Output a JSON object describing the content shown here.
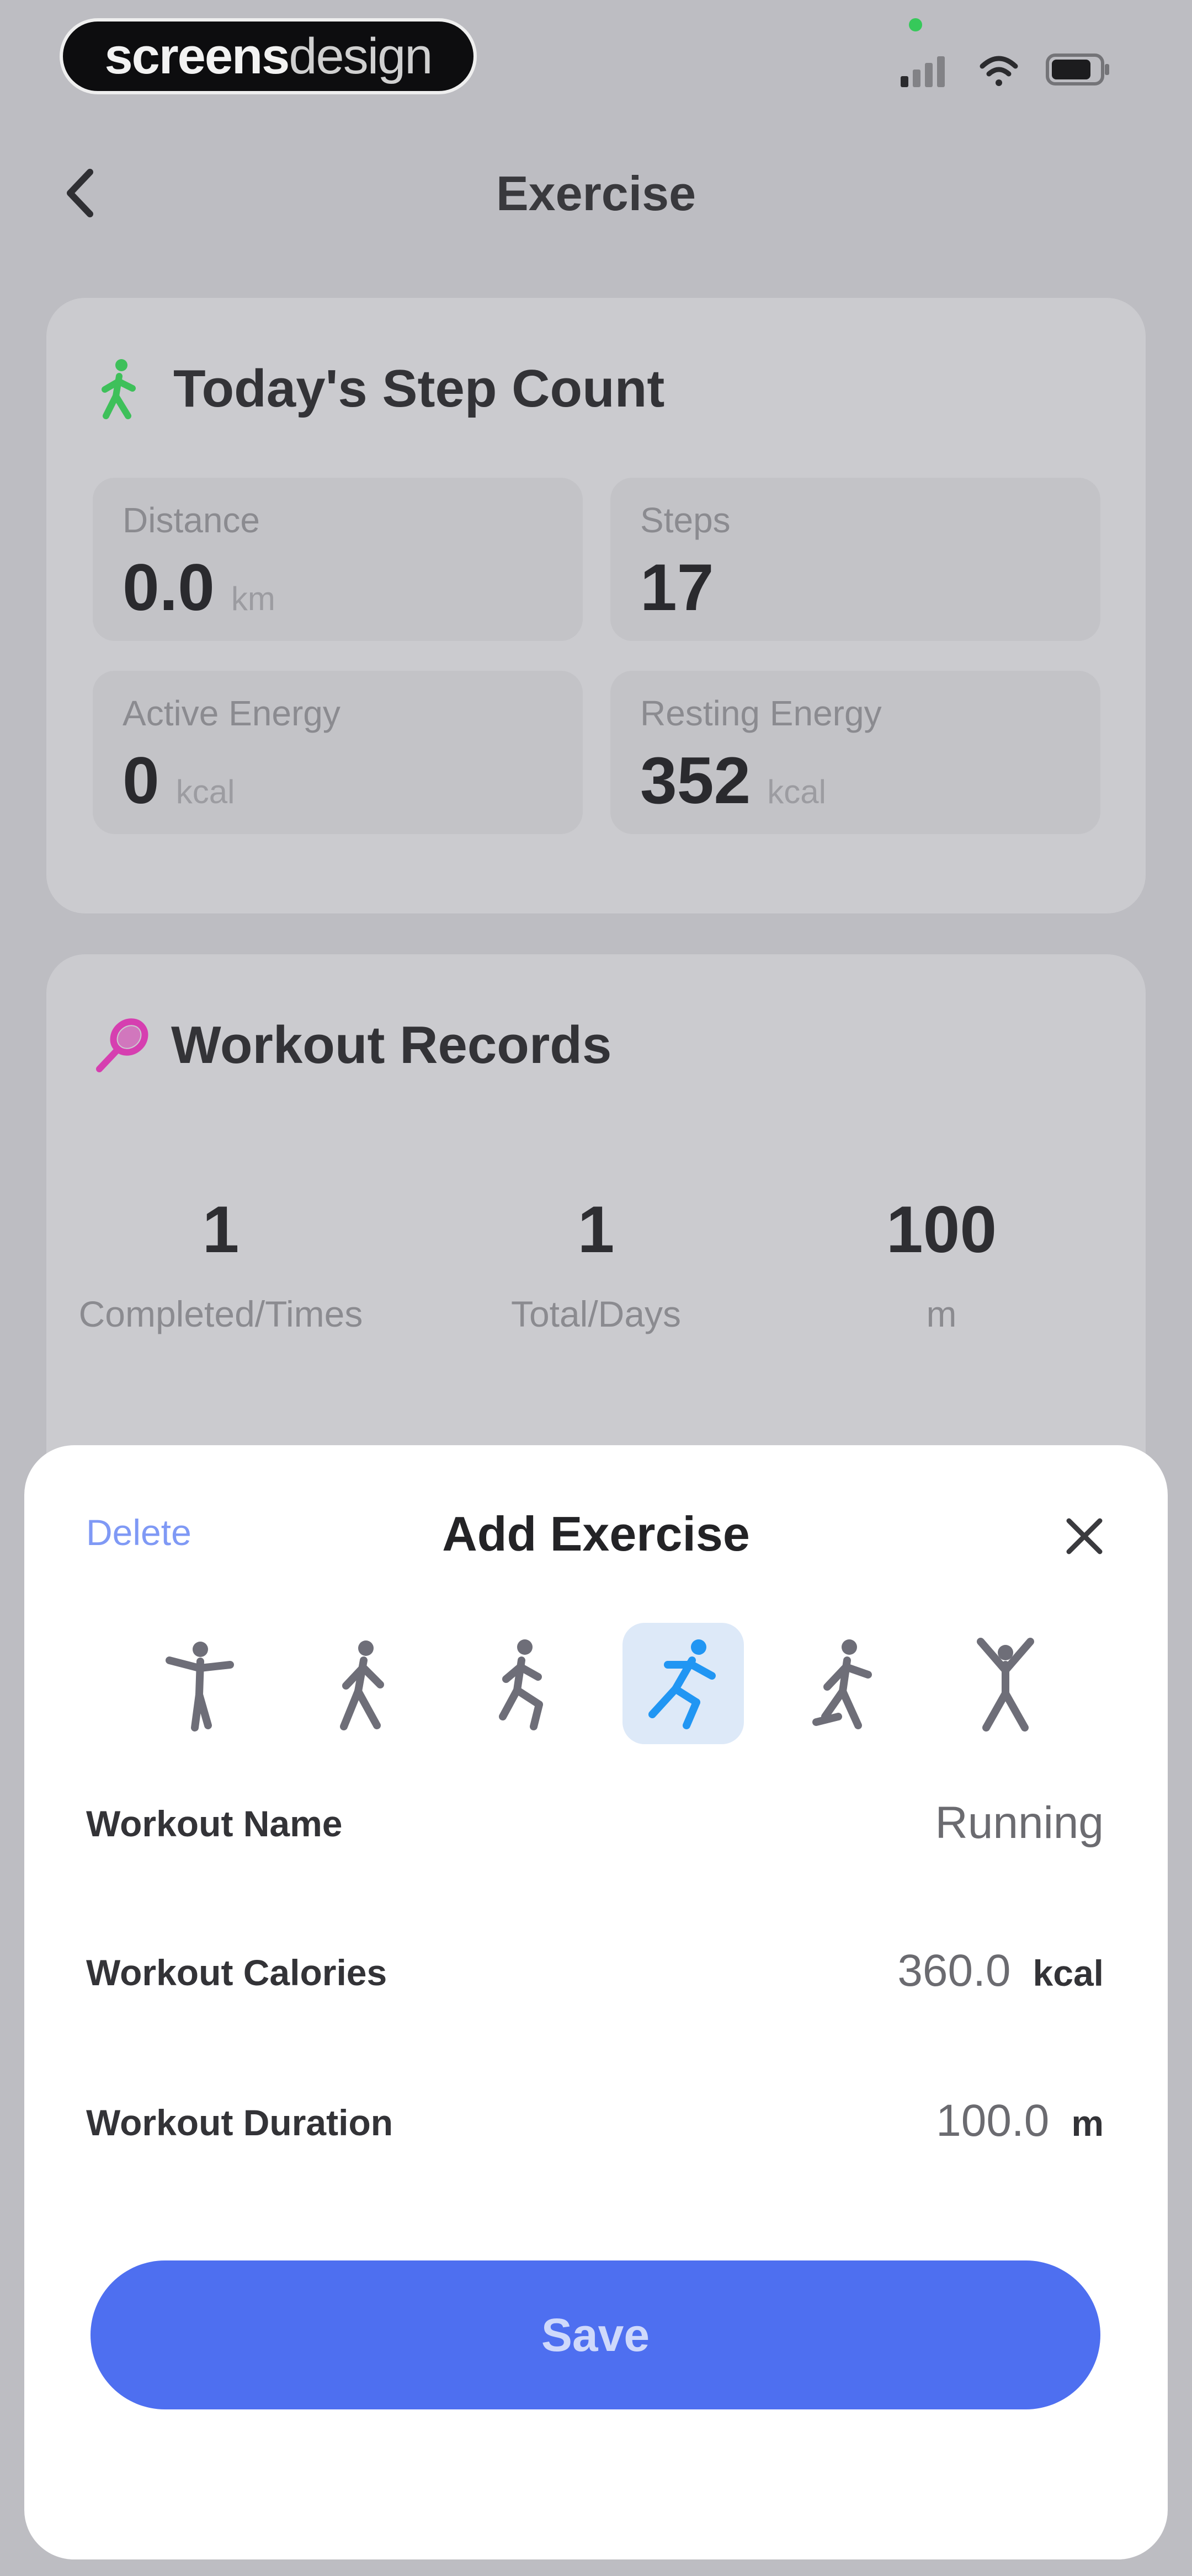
{
  "status_bar": {
    "brand_bold": "screens",
    "brand_light": "design"
  },
  "nav": {
    "title": "Exercise"
  },
  "step_card": {
    "title": "Today's Step Count",
    "tiles": [
      {
        "label": "Distance",
        "value": "0.0",
        "unit": "km"
      },
      {
        "label": "Steps",
        "value": "17",
        "unit": ""
      },
      {
        "label": "Active Energy",
        "value": "0",
        "unit": "kcal"
      },
      {
        "label": "Resting Energy",
        "value": "352",
        "unit": "kcal"
      }
    ]
  },
  "records_card": {
    "title": "Workout Records",
    "stats": [
      {
        "value": "1",
        "label": "Completed/Times"
      },
      {
        "value": "1",
        "label": "Total/Days"
      },
      {
        "value": "100",
        "label": "m"
      }
    ]
  },
  "sheet": {
    "delete_label": "Delete",
    "title": "Add Exercise",
    "exercise_types": [
      {
        "icon": "stretch-figure-icon",
        "selected": false
      },
      {
        "icon": "walking-figure-icon",
        "selected": false
      },
      {
        "icon": "jogging-figure-icon",
        "selected": false
      },
      {
        "icon": "running-figure-icon",
        "selected": true
      },
      {
        "icon": "skating-figure-icon",
        "selected": false
      },
      {
        "icon": "jumping-jack-figure-icon",
        "selected": false
      }
    ],
    "rows": [
      {
        "label": "Workout Name",
        "value": "Running",
        "unit": ""
      },
      {
        "label": "Workout Calories",
        "value": "360.0",
        "unit": "kcal"
      },
      {
        "label": "Workout Duration",
        "value": "100.0",
        "unit": "m"
      }
    ],
    "save_label": "Save"
  },
  "colors": {
    "accent": "#4e6ff0",
    "step_icon": "#3ec05a",
    "records_icon": "#d63fb0",
    "selected_bg": "#dde9f8",
    "selected_icon": "#2196f3"
  }
}
